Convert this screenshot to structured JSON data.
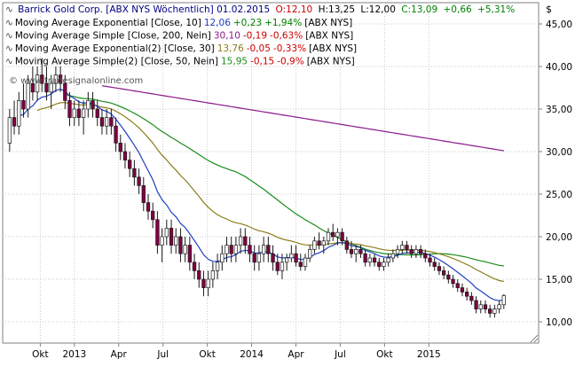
{
  "chart_data": {
    "type": "candlestick",
    "title": "Barrick Gold Corp. [ABX NYS  Wöchentlich] 01.02.2015",
    "quote": {
      "open": "O:12,10",
      "high": "H:13,25",
      "low": "L:12,00",
      "close": "C:13,09",
      "change": "+0,66",
      "change_pct": "+5,31%"
    },
    "watermark": "© www.tradesignalonline.com",
    "y_axis": {
      "unit": "$",
      "ticks": [
        "10,00",
        "15,00",
        "20,00",
        "25,00",
        "30,00",
        "35,00",
        "40,00",
        "45,00"
      ],
      "ylim": [
        7.5,
        47.5
      ]
    },
    "x_axis": {
      "labels": [
        "Okt",
        "2013",
        "Apr",
        "Jul",
        "Okt",
        "2014",
        "Apr",
        "Jul",
        "Okt",
        "2015"
      ]
    },
    "grid": true,
    "legend_position": "top-left",
    "indicators": [
      {
        "label": "Moving Average Exponential [Close, 10]",
        "value": "12,06",
        "change": "+0,23",
        "change_pct": "+1,94%",
        "suffix": "[ABX NYS]",
        "color": "#1f3fbf"
      },
      {
        "label": "Moving Average Simple [Close, 200, Nein]",
        "value": "30,10",
        "change": "-0,19",
        "change_pct": "-0,63%",
        "suffix": "[ABX NYS]",
        "color": "#8b1a8b"
      },
      {
        "label": "Moving Average Exponential(2) [Close, 30]",
        "value": "13,76",
        "change": "-0,05",
        "change_pct": "-0,33%",
        "suffix": "[ABX NYS]",
        "color": "#8b7d1a"
      },
      {
        "label": "Moving Average Simple(2) [Close, 50, Nein]",
        "value": "15,95",
        "change": "-0,15",
        "change_pct": "-0,9%",
        "suffix": "[ABX NYS]",
        "color": "#1a8b1a"
      }
    ],
    "colors": {
      "title": "#000080",
      "positive": "#008000",
      "negative": "#cc0000",
      "candle_down": "#800040",
      "candle_up": "#ffffff"
    },
    "x_range_weeks": [
      0,
      151
    ],
    "x_label_weeks": [
      10,
      20,
      33,
      46,
      59,
      72,
      85,
      98,
      111,
      124
    ],
    "candles": [
      [
        31,
        35,
        30,
        34
      ],
      [
        34,
        36,
        32,
        33
      ],
      [
        33,
        37,
        32,
        36
      ],
      [
        36,
        38,
        34,
        35
      ],
      [
        35,
        39,
        34,
        38
      ],
      [
        38,
        40,
        36,
        37
      ],
      [
        37,
        40,
        36,
        39
      ],
      [
        39,
        41,
        37,
        38
      ],
      [
        38,
        40,
        36,
        37
      ],
      [
        37,
        39,
        35,
        38
      ],
      [
        38,
        40,
        37,
        39
      ],
      [
        39,
        40,
        37,
        38
      ],
      [
        38,
        39,
        35,
        36
      ],
      [
        36,
        37,
        33,
        34
      ],
      [
        34,
        36,
        33,
        35
      ],
      [
        35,
        36,
        33,
        34
      ],
      [
        34,
        36,
        32,
        35
      ],
      [
        35,
        37,
        34,
        36
      ],
      [
        36,
        37,
        34,
        35
      ],
      [
        35,
        36,
        33,
        34
      ],
      [
        34,
        35,
        32,
        33
      ],
      [
        33,
        35,
        32,
        34
      ],
      [
        34,
        35,
        32,
        33
      ],
      [
        33,
        34,
        30,
        31
      ],
      [
        31,
        32,
        29,
        30
      ],
      [
        30,
        31,
        28,
        29
      ],
      [
        29,
        30,
        27,
        28
      ],
      [
        28,
        29,
        26,
        27
      ],
      [
        27,
        28,
        25,
        26
      ],
      [
        26,
        27,
        23,
        24
      ],
      [
        24,
        25,
        22,
        23
      ],
      [
        23,
        24,
        21,
        22
      ],
      [
        22,
        23,
        18,
        19
      ],
      [
        19,
        21,
        17,
        20
      ],
      [
        20,
        22,
        19,
        21
      ],
      [
        21,
        22,
        18,
        19
      ],
      [
        19,
        21,
        18,
        20
      ],
      [
        20,
        21,
        17,
        18
      ],
      [
        18,
        20,
        17,
        19
      ],
      [
        19,
        20,
        16,
        17
      ],
      [
        17,
        18,
        15,
        16
      ],
      [
        16,
        17,
        14,
        15
      ],
      [
        15,
        16,
        13,
        14
      ],
      [
        14,
        16,
        13,
        15
      ],
      [
        15,
        17,
        14,
        16
      ],
      [
        16,
        18,
        15,
        17
      ],
      [
        17,
        19,
        16,
        18
      ],
      [
        18,
        20,
        17,
        19
      ],
      [
        19,
        20,
        17,
        18
      ],
      [
        18,
        20,
        17,
        19
      ],
      [
        19,
        21,
        18,
        20
      ],
      [
        20,
        21,
        18,
        19
      ],
      [
        19,
        20,
        17,
        18
      ],
      [
        18,
        19,
        16,
        17
      ],
      [
        17,
        19,
        16,
        18
      ],
      [
        18,
        20,
        17,
        19
      ],
      [
        19,
        20,
        17,
        18
      ],
      [
        18,
        19,
        16,
        17
      ],
      [
        17,
        18,
        15.5,
        16
      ],
      [
        16,
        18,
        15,
        17
      ],
      [
        17,
        18,
        16,
        17.5
      ],
      [
        17.5,
        19,
        17,
        18
      ],
      [
        18,
        19,
        16.5,
        17
      ],
      [
        17,
        18,
        16,
        16.5
      ],
      [
        16.5,
        18,
        16,
        17.5
      ],
      [
        17.5,
        19,
        17,
        18.5
      ],
      [
        18.5,
        20,
        18,
        19.5
      ],
      [
        19.5,
        20.5,
        18.5,
        19
      ],
      [
        19,
        20,
        18,
        19.5
      ],
      [
        19.5,
        21,
        19,
        20.5
      ],
      [
        20.5,
        21.5,
        19.5,
        20
      ],
      [
        20,
        21,
        19,
        20.5
      ],
      [
        20.5,
        21,
        19,
        19.5
      ],
      [
        19.5,
        20,
        18,
        18.5
      ],
      [
        18.5,
        19.5,
        17.5,
        18
      ],
      [
        18,
        19,
        17,
        18.5
      ],
      [
        18.5,
        19,
        17.5,
        18
      ],
      [
        18,
        18.5,
        16.5,
        17
      ],
      [
        17,
        18,
        16.5,
        17.5
      ],
      [
        17.5,
        18,
        16.5,
        17
      ],
      [
        17,
        17.5,
        16,
        16.5
      ],
      [
        16.5,
        17.5,
        16,
        17
      ],
      [
        17,
        18,
        16.5,
        17.5
      ],
      [
        17.5,
        18.5,
        17,
        18
      ],
      [
        18,
        19,
        17.5,
        18.5
      ],
      [
        18.5,
        19.5,
        18,
        19
      ],
      [
        19,
        19.5,
        18,
        18.5
      ],
      [
        18.5,
        19,
        17.5,
        18
      ],
      [
        18,
        19,
        17.5,
        18.5
      ],
      [
        18.5,
        19,
        17.5,
        18
      ],
      [
        18,
        18.5,
        17,
        17.5
      ],
      [
        17.5,
        18,
        16.5,
        17
      ],
      [
        17,
        17.5,
        16,
        16.5
      ],
      [
        16.5,
        17,
        15.5,
        16
      ],
      [
        16,
        16.5,
        15,
        15.5
      ],
      [
        15.5,
        16,
        14.5,
        15
      ],
      [
        15,
        15.5,
        14,
        14.5
      ],
      [
        14.5,
        15,
        13.5,
        14
      ],
      [
        14,
        14.5,
        13,
        13.5
      ],
      [
        13.5,
        14,
        12.5,
        13
      ],
      [
        13,
        13.5,
        12,
        12.5
      ],
      [
        12.5,
        13,
        11,
        11.5
      ],
      [
        11.5,
        12.5,
        11,
        12
      ],
      [
        12,
        12.5,
        11,
        11.5
      ],
      [
        11.5,
        12,
        10.5,
        11
      ],
      [
        11,
        12,
        10.5,
        11.5
      ],
      [
        11.5,
        12.5,
        11,
        12
      ],
      [
        12,
        13.25,
        11.5,
        13.09
      ]
    ],
    "ma200": [
      [
        0,
        null
      ]
    ],
    "ma_ema10": [],
    "ma_ema30": [],
    "ma_sma50": []
  }
}
